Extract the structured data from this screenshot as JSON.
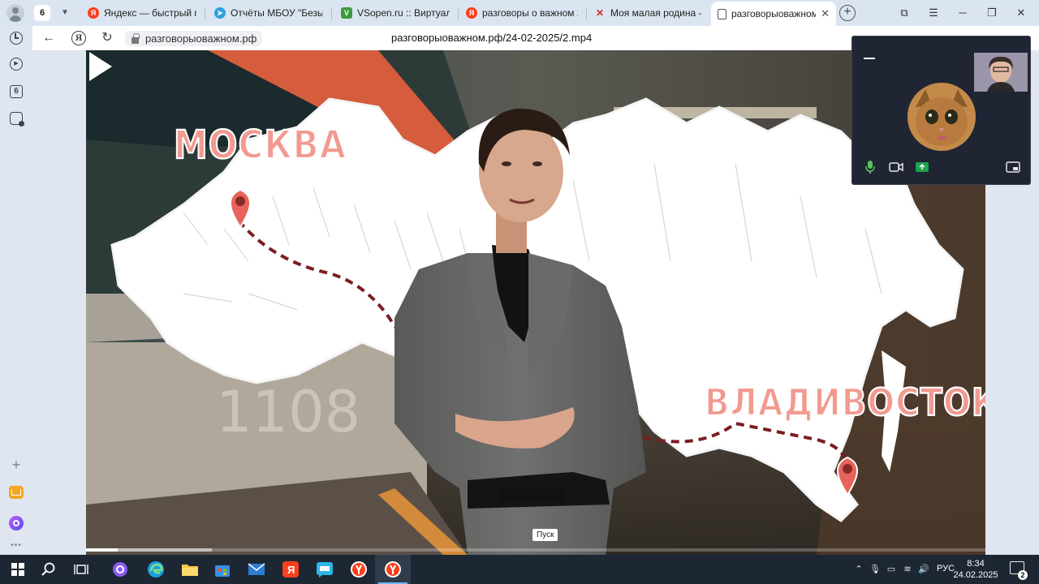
{
  "browser": {
    "tab_count": "6",
    "tabs": [
      {
        "title": "Яндекс — быстрый пои",
        "favicon": "yandex-icon",
        "color": "#fc3f1d",
        "glyph": "Я"
      },
      {
        "title": "Отчёты МБОУ \"Безыме",
        "favicon": "telegram-icon",
        "color": "#2aa3df",
        "glyph": "➤"
      },
      {
        "title": "VSopen.ru :: Виртуальн",
        "favicon": "vsopen-icon",
        "color": "#3c9b3c",
        "glyph": "V"
      },
      {
        "title": "разговоры о важном 2",
        "favicon": "yandex-icon",
        "color": "#fc3f1d",
        "glyph": "Я"
      },
      {
        "title": "Моя малая родина — Р",
        "favicon": "rzhd-icon",
        "color": "#d42a2a",
        "glyph": "Р"
      },
      {
        "title": "разговорыоважном",
        "favicon": "page-icon",
        "color": "#ffffff",
        "glyph": ""
      }
    ],
    "domain": "разговорыоважном.рф",
    "page_title": "разговорыоважном.рф/24-02-2025/2.mp4"
  },
  "video": {
    "map_labels": {
      "moscow": "МОСКВА",
      "vladivostok": "ВЛАДИВОСТОК"
    },
    "train_number": "1108",
    "play_tooltip": "Пуск",
    "progress_played": 0.035,
    "progress_buffered": 0.14
  },
  "call": {
    "mic_color": "#58c35a",
    "screen_share_color": "#1ea34d"
  },
  "taskbar": {
    "language": "РУС",
    "time": "8:34",
    "date": "24.02.2025",
    "notifications": "2"
  }
}
